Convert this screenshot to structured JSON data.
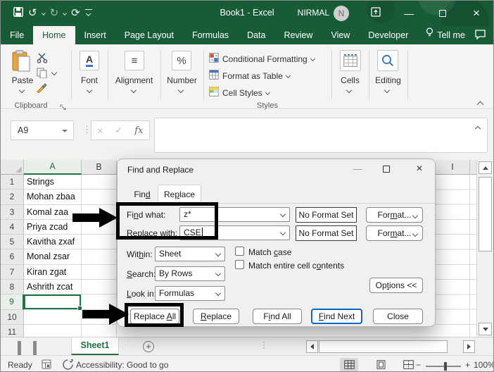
{
  "titlebar": {
    "title": "Book1 - Excel",
    "user": "NIRMAL",
    "avatar_initial": "N"
  },
  "ribbon_tabs": {
    "file": "File",
    "home": "Home",
    "insert": "Insert",
    "page_layout": "Page Layout",
    "formulas": "Formulas",
    "data": "Data",
    "review": "Review",
    "view": "View",
    "developer": "Developer",
    "tell_me": "Tell me"
  },
  "ribbon": {
    "paste": "Paste",
    "clipboard_group": "Clipboard",
    "font_group": "Font",
    "alignment_group": "Alignment",
    "number_group": "Number",
    "conditional_formatting": "Conditional Formatting",
    "format_as_table": "Format as Table",
    "cell_styles": "Cell Styles",
    "styles_group": "Styles",
    "cells_group": "Cells",
    "editing_group": "Editing"
  },
  "formula_bar": {
    "name_box": "A9"
  },
  "grid": {
    "col_a": "A",
    "col_b": "B",
    "col_i": "I",
    "rows": [
      {
        "n": "1",
        "a": "Strings"
      },
      {
        "n": "2",
        "a": "Mohan zbaa"
      },
      {
        "n": "3",
        "a": "Komal zaa"
      },
      {
        "n": "4",
        "a": "Priya zcad"
      },
      {
        "n": "5",
        "a": "Kavitha zxaf"
      },
      {
        "n": "6",
        "a": "Monal zsar"
      },
      {
        "n": "7",
        "a": "Kiran zgat"
      },
      {
        "n": "8",
        "a": "Ashrith zcat"
      },
      {
        "n": "9",
        "a": "",
        "selected": true
      },
      {
        "n": "10",
        "a": ""
      },
      {
        "n": "11",
        "a": ""
      }
    ]
  },
  "dialog": {
    "title": "Find and Replace",
    "tab_find": "Fin&d",
    "tab_replace": "Re&place",
    "find_what_label": "Fi&nd what:",
    "find_what_value": "z*",
    "replace_with_label": "&Replace with:",
    "replace_with_value": "CSE",
    "no_format_set": "No Format Set",
    "format_button": "For&mat...",
    "within_label": "Wit&hin:",
    "within_value": "Sheet",
    "search_label": "&Search:",
    "search_value": "By Rows",
    "look_in_label": "&Look in:",
    "look_in_value": "Formulas",
    "match_case": "Match &case",
    "match_entire": "Match entire cell c&ontents",
    "options_button": "Op&tions <<",
    "replace_all_button": "Replace &All",
    "replace_button": "&Replace",
    "find_all_button": "F&ind All",
    "find_next_button": "&Find Next",
    "close_button": "Close"
  },
  "sheet_bar": {
    "sheet1": "Sheet1"
  },
  "status_bar": {
    "ready": "Ready",
    "accessibility": "Accessibility: Good to go",
    "zoom": "100%"
  },
  "icons": {
    "undo": "↺",
    "redo": "↻",
    "refresh": "⟳",
    "cancel": "×",
    "check": "✓",
    "fx": "fx",
    "font_letter": "A",
    "percent": "%",
    "align": "≡",
    "minimize": "—",
    "close": "×",
    "dots_v": "⋮",
    "zoom_minus": "−",
    "zoom_plus": "+",
    "add_sheet": "+"
  },
  "colors": {
    "excel_green_titlebar": "#185C37",
    "accent_green": "#217346",
    "focus_blue": "#0067C0",
    "ribbon_bg": "#F5F4F2",
    "annotation_black": "#000000"
  }
}
